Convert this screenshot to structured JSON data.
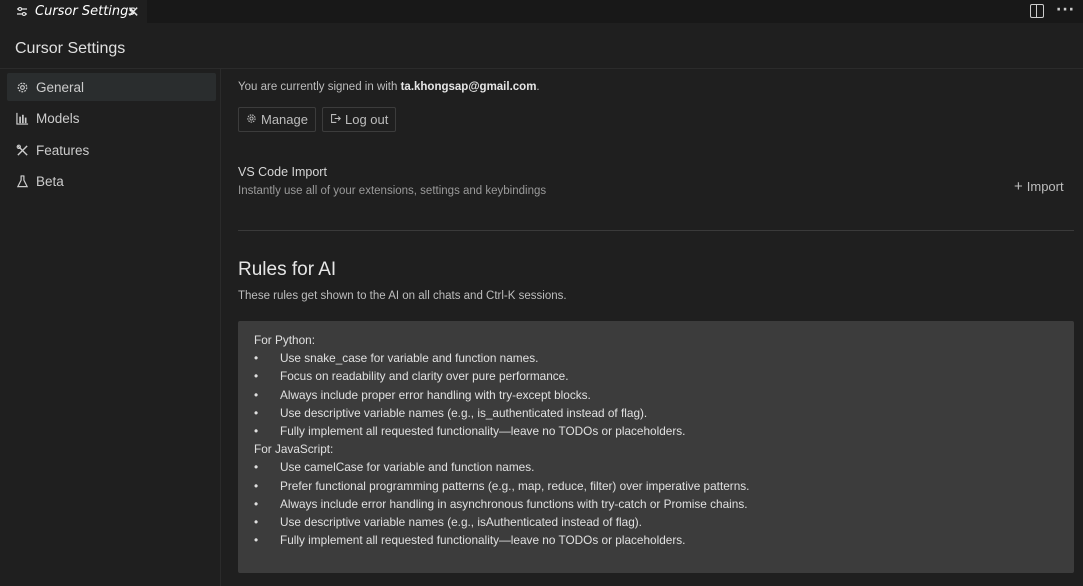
{
  "tab": {
    "label": "Cursor Settings",
    "close": "✕"
  },
  "header": {
    "title": "Cursor Settings"
  },
  "sidebar": {
    "items": [
      {
        "label": "General",
        "icon": "gear-icon",
        "active": true
      },
      {
        "label": "Models",
        "icon": "chart-icon"
      },
      {
        "label": "Features",
        "icon": "tools-icon"
      },
      {
        "label": "Beta",
        "icon": "flask-icon"
      }
    ]
  },
  "account": {
    "signed_in_prefix": "You are currently signed in with",
    "email": "ta.khongsap@gmail.com",
    "suffix": ".",
    "manage_label": "Manage",
    "logout_label": "Log out"
  },
  "import": {
    "title": "VS Code Import",
    "description": "Instantly use all of your extensions, settings and keybindings",
    "button_label": "Import"
  },
  "rules": {
    "title": "Rules for AI",
    "description": "These rules get shown to the AI on all chats and Ctrl-K sessions.",
    "lines": [
      {
        "text": "For Python:",
        "bullet": false
      },
      {
        "text": "Use snake_case for variable and function names.",
        "bullet": true
      },
      {
        "text": "Focus on readability and clarity over pure performance.",
        "bullet": true
      },
      {
        "text": "Always include proper error handling with try-except blocks.",
        "bullet": true
      },
      {
        "text": "Use descriptive variable names (e.g., is_authenticated instead of flag).",
        "bullet": true
      },
      {
        "text": "Fully implement all requested functionality—leave no TODOs or placeholders.",
        "bullet": true
      },
      {
        "text": "For JavaScript:",
        "bullet": false
      },
      {
        "text": "Use camelCase for variable and function names.",
        "bullet": true
      },
      {
        "text": "Prefer functional programming patterns (e.g., map, reduce, filter) over imperative patterns.",
        "bullet": true
      },
      {
        "text": "Always include error handling in asynchronous functions with try-catch or Promise chains.",
        "bullet": true
      },
      {
        "text": "Use descriptive variable names (e.g., isAuthenticated instead of flag).",
        "bullet": true
      },
      {
        "text": "Fully implement all requested functionality—leave no TODOs or placeholders.",
        "bullet": true
      }
    ]
  },
  "colors": {
    "accent": "#0078d4",
    "background": "#1f1f1f",
    "rules_box": "#3c3c3c"
  }
}
